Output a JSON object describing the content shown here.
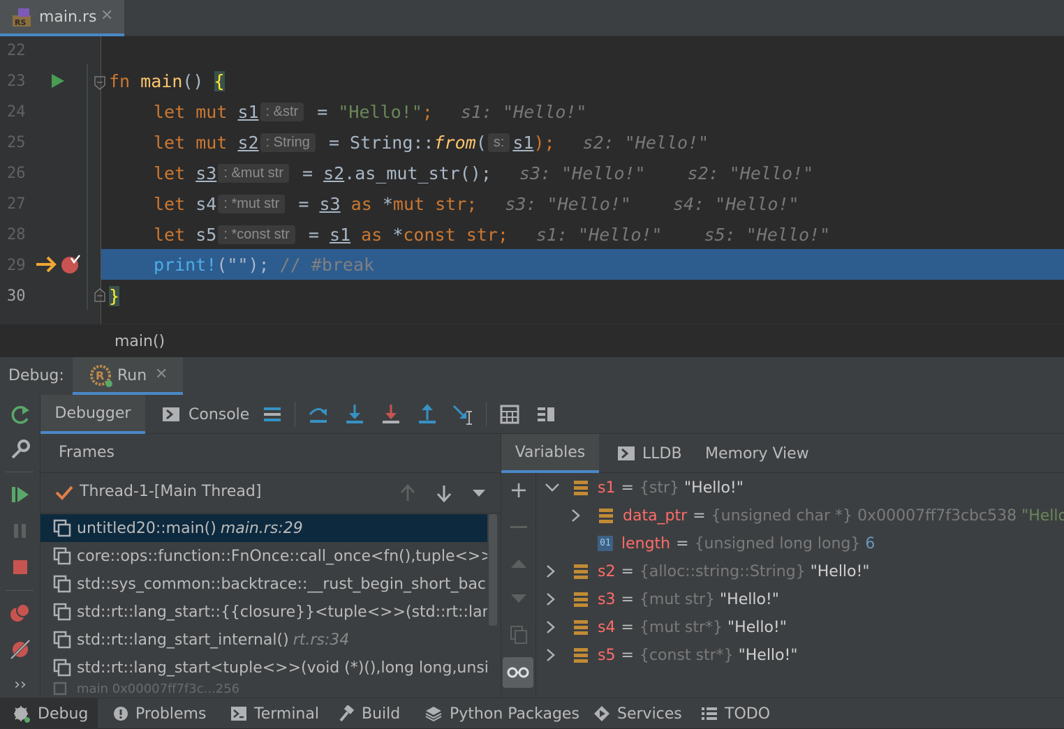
{
  "editor_tab": {
    "filename": "main.rs"
  },
  "editor": {
    "line_numbers": [
      "22",
      "23",
      "24",
      "25",
      "26",
      "27",
      "28",
      "29",
      "30"
    ],
    "lines": {
      "l23": {
        "fn": "fn",
        "name": " main",
        "rest": "() ",
        "brace": "{"
      },
      "l24": {
        "let": "let",
        "mut": "mut",
        "var": "s1",
        "hint": ": &str",
        "eq": " = ",
        "val": "\"Hello!\"",
        "semi": ";",
        "inline": "s1: \"Hello!\""
      },
      "l25": {
        "let": "let",
        "mut": "mut",
        "var": "s2",
        "hint": ": String",
        "eq": " = String::",
        "from": "from",
        "paren": "(",
        "phint": "s:",
        "arg": "s1",
        "close": ");",
        "inline": "s2: \"Hello!\""
      },
      "l26": {
        "let": "let",
        "var": "s3",
        "hint": ": &mut str",
        "eq": " = ",
        "src": "s2",
        "call": ".as_mut_str();",
        "inline1": "s3: \"Hello!\"",
        "inline2": "s2: \"Hello!\""
      },
      "l27": {
        "let": "let",
        "var": "s4",
        "hint": ": *mut str",
        "eq": " = ",
        "src": "s3",
        "as": "as",
        "ptr": "*",
        "mut": "mut",
        "ty": " str;",
        "inline1": "s3: \"Hello!\"",
        "inline2": "s4: \"Hello!\""
      },
      "l28": {
        "let": "let",
        "var": "s5",
        "hint": ": *const str",
        "eq": " = ",
        "src": "s1",
        "as": "as",
        "ptr": "*",
        "const": "const",
        "ty": " str;",
        "inline1": "s1: \"Hello!\"",
        "inline2": "s5: \"Hello!\""
      },
      "l29": {
        "mac": "print!",
        "args": "(\"\");",
        "cmt": " // #break"
      },
      "l30": {
        "brace": "}"
      }
    }
  },
  "breadcrumb": {
    "label": "main()"
  },
  "debug_panel": {
    "title": "Debug:",
    "run_tab": "Run",
    "tabs": {
      "debugger": "Debugger",
      "console": "Console"
    },
    "frames_title": "Frames",
    "thread": "Thread-1-[Main Thread]",
    "frames": [
      {
        "name": "untitled20::main()",
        "loc": "main.rs:29"
      },
      {
        "name": "core::ops::function::FnOnce::call_once<fn(),tuple<>>(void",
        "loc": ""
      },
      {
        "name": "std::sys_common::backtrace::__rust_begin_short_backtrace",
        "loc": ""
      },
      {
        "name": "std::rt::lang_start::{{closure}}<tuple<>>(std::rt::lang_start::cl",
        "loc": ""
      },
      {
        "name": "std::rt::lang_start_internal()",
        "loc": "rt.rs:34"
      },
      {
        "name": "std::rt::lang_start<tuple<>>(void (*)(),long long,unsigned",
        "loc": ""
      },
      {
        "name": "main 0x00007ff7f3c...256",
        "loc": ""
      }
    ],
    "vars_tabs": {
      "variables": "Variables",
      "lldb": "LLDB",
      "memory": "Memory View"
    },
    "variables": {
      "s1": {
        "name": "s1",
        "type": "{str}",
        "value": "\"Hello!\""
      },
      "data_ptr": {
        "name": "data_ptr",
        "type": "{unsigned char *}",
        "value": "0x00007ff7f3cbc538",
        "str": "\"Hello!\""
      },
      "length": {
        "name": "length",
        "type": "{unsigned long long}",
        "value": "6",
        "badge": "01"
      },
      "s2": {
        "name": "s2",
        "type": "{alloc::string::String}",
        "value": "\"Hello!\""
      },
      "s3": {
        "name": "s3",
        "type": "{mut str}",
        "value": "\"Hello!\""
      },
      "s4": {
        "name": "s4",
        "type": "{mut str*}",
        "value": "\"Hello!\""
      },
      "s5": {
        "name": "s5",
        "type": "{const str*}",
        "value": "\"Hello!\""
      }
    }
  },
  "statusbar": {
    "debug": "Debug",
    "problems": "Problems",
    "terminal": "Terminal",
    "build": "Build",
    "python": "Python Packages",
    "services": "Services",
    "todo": "TODO"
  },
  "colors": {
    "accent": "#4a88c7",
    "highlight": "#2d5c8f",
    "keyword": "#cc7832",
    "string": "#6a8759",
    "var_name": "#ff6b68"
  }
}
